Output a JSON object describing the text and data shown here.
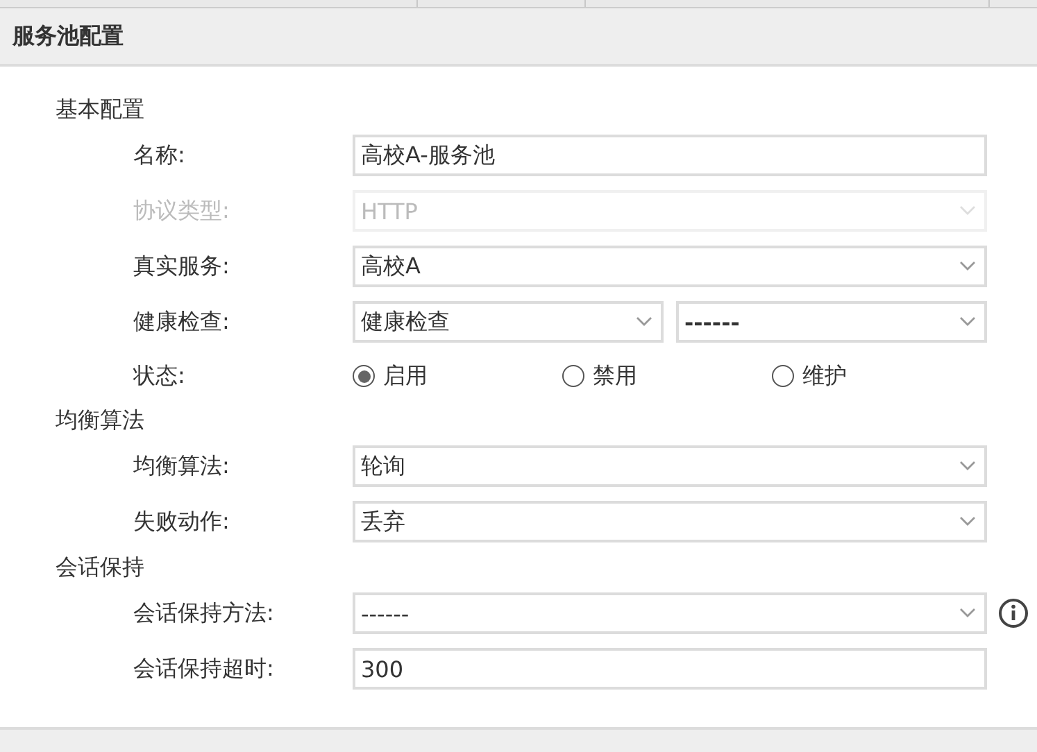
{
  "dialog": {
    "title": "服务池配置"
  },
  "sections": [
    {
      "title": "基本配置",
      "fields": [
        {
          "kind": "text",
          "label": "名称:",
          "value": "高校A-服务池",
          "disabled": false
        },
        {
          "kind": "select",
          "label": "协议类型:",
          "value": "HTTP",
          "disabled": true
        },
        {
          "kind": "select",
          "label": "真实服务:",
          "value": "高校A",
          "disabled": false
        },
        {
          "kind": "select_pair",
          "label": "健康检查:",
          "values": [
            "健康检查",
            "------"
          ],
          "disabled": false
        },
        {
          "kind": "radio",
          "label": "状态:",
          "options": [
            {
              "label": "启用",
              "selected": true
            },
            {
              "label": "禁用",
              "selected": false
            },
            {
              "label": "维护",
              "selected": false
            }
          ]
        }
      ]
    },
    {
      "title": "均衡算法",
      "fields": [
        {
          "kind": "select",
          "label": "均衡算法:",
          "value": "轮询",
          "disabled": false
        },
        {
          "kind": "select",
          "label": "失败动作:",
          "value": "丢弃",
          "disabled": false
        }
      ]
    },
    {
      "title": "会话保持",
      "fields": [
        {
          "kind": "select",
          "label": "会话保持方法:",
          "value": "------",
          "disabled": false,
          "info": true
        },
        {
          "kind": "text",
          "label": "会话保持超时:",
          "value": "300",
          "disabled": false
        }
      ]
    }
  ]
}
